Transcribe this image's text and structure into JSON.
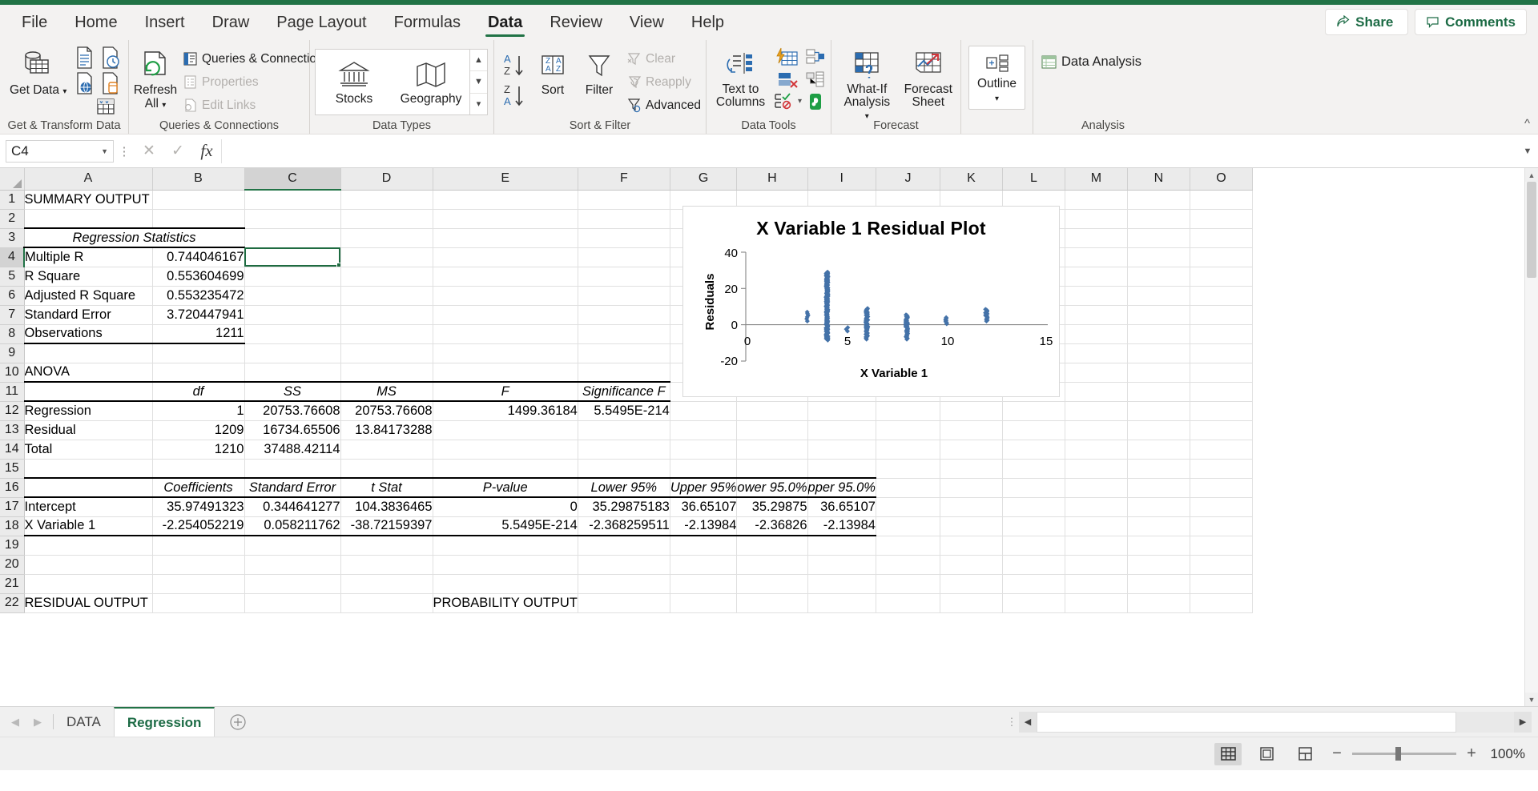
{
  "ribbon": {
    "tabs": [
      {
        "label": "File",
        "active": false
      },
      {
        "label": "Home",
        "active": false
      },
      {
        "label": "Insert",
        "active": false
      },
      {
        "label": "Draw",
        "active": false
      },
      {
        "label": "Page Layout",
        "active": false
      },
      {
        "label": "Formulas",
        "active": false
      },
      {
        "label": "Data",
        "active": true
      },
      {
        "label": "Review",
        "active": false
      },
      {
        "label": "View",
        "active": false
      },
      {
        "label": "Help",
        "active": false
      }
    ],
    "share_label": "Share",
    "comments_label": "Comments",
    "groups": {
      "get_transform": {
        "label": "Get & Transform Data",
        "get_data": "Get Data"
      },
      "queries": {
        "label": "Queries & Connections",
        "refresh_all": "Refresh All",
        "queries_connections": "Queries & Connections",
        "properties": "Properties",
        "edit_links": "Edit Links"
      },
      "data_types": {
        "label": "Data Types",
        "stocks": "Stocks",
        "geography": "Geography"
      },
      "sort_filter": {
        "label": "Sort & Filter",
        "sort": "Sort",
        "filter": "Filter",
        "clear": "Clear",
        "reapply": "Reapply",
        "advanced": "Advanced"
      },
      "data_tools": {
        "label": "Data Tools",
        "text_to_columns": "Text to Columns"
      },
      "forecast": {
        "label": "Forecast",
        "what_if": "What-If Analysis",
        "forecast_sheet": "Forecast Sheet"
      },
      "outline": {
        "label": "",
        "outline": "Outline"
      },
      "analysis": {
        "label": "Analysis",
        "data_analysis": "Data Analysis"
      }
    }
  },
  "formula_bar": {
    "name_box_value": "C4",
    "formula_value": ""
  },
  "grid": {
    "columns": [
      "A",
      "B",
      "C",
      "D",
      "E",
      "F",
      "G",
      "H",
      "I",
      "J",
      "K",
      "L",
      "M",
      "N",
      "O"
    ],
    "selected_column": "C",
    "selected_row": "4",
    "selected_cell": "C4",
    "rows": [
      {
        "n": "1",
        "cells": {
          "A": "SUMMARY OUTPUT"
        }
      },
      {
        "n": "2",
        "cells": {}
      },
      {
        "n": "3",
        "cells": {
          "AB": "Regression Statistics"
        }
      },
      {
        "n": "4",
        "cells": {
          "A": "Multiple R",
          "B": "0.744046167"
        }
      },
      {
        "n": "5",
        "cells": {
          "A": "R Square",
          "B": "0.553604699"
        }
      },
      {
        "n": "6",
        "cells": {
          "A": "Adjusted R Square",
          "B": "0.553235472"
        }
      },
      {
        "n": "7",
        "cells": {
          "A": "Standard Error",
          "B": "3.720447941"
        }
      },
      {
        "n": "8",
        "cells": {
          "A": "Observations",
          "B": "1211"
        }
      },
      {
        "n": "9",
        "cells": {}
      },
      {
        "n": "10",
        "cells": {
          "A": "ANOVA"
        }
      },
      {
        "n": "11",
        "cells": {
          "B": "df",
          "C": "SS",
          "D": "MS",
          "E": "F",
          "F": "Significance F"
        }
      },
      {
        "n": "12",
        "cells": {
          "A": "Regression",
          "B": "1",
          "C": "20753.76608",
          "D": "20753.76608",
          "E": "1499.36184",
          "F": "5.5495E-214"
        }
      },
      {
        "n": "13",
        "cells": {
          "A": "Residual",
          "B": "1209",
          "C": "16734.65506",
          "D": "13.84173288"
        }
      },
      {
        "n": "14",
        "cells": {
          "A": "Total",
          "B": "1210",
          "C": "37488.42114"
        }
      },
      {
        "n": "15",
        "cells": {}
      },
      {
        "n": "16",
        "cells": {
          "B": "Coefficients",
          "C": "Standard Error",
          "D": "t Stat",
          "E": "P-value",
          "F": "Lower 95%",
          "G": "Upper 95%",
          "H": "ower 95.0%",
          "I": "pper 95.0%"
        }
      },
      {
        "n": "17",
        "cells": {
          "A": "Intercept",
          "B": "35.97491323",
          "C": "0.344641277",
          "D": "104.3836465",
          "E": "0",
          "F": "35.29875183",
          "G": "36.65107",
          "H": "35.29875",
          "I": "36.65107"
        }
      },
      {
        "n": "18",
        "cells": {
          "A": "X Variable 1",
          "B": "-2.254052219",
          "C": "0.058211762",
          "D": "-38.72159397",
          "E": "5.5495E-214",
          "F": "-2.368259511",
          "G": "-2.13984",
          "H": "-2.36826",
          "I": "-2.13984"
        }
      },
      {
        "n": "19",
        "cells": {}
      },
      {
        "n": "20",
        "cells": {}
      },
      {
        "n": "21",
        "cells": {}
      },
      {
        "n": "22",
        "cells": {
          "A": "RESIDUAL OUTPUT",
          "E": "PROBABILITY OUTPUT"
        }
      }
    ]
  },
  "chart_data": {
    "type": "scatter",
    "title": "X Variable 1  Residual Plot",
    "xlabel": "X Variable 1",
    "ylabel": "Residuals",
    "xlim": [
      0,
      15
    ],
    "ylim": [
      -20,
      40
    ],
    "xticks": [
      "0",
      "5",
      "10",
      "15"
    ],
    "yticks": [
      "40",
      "20",
      "0",
      "-20"
    ],
    "grid": false,
    "legend": "none",
    "marker_color": "#4472a8",
    "clusters": [
      {
        "x": 3,
        "y_min": 2.0,
        "y_max": 7.0,
        "n": 6
      },
      {
        "x": 4,
        "y_min": -8.5,
        "y_max": 29.0,
        "n": 170
      },
      {
        "x": 5,
        "y_min": -3.5,
        "y_max": -1.5,
        "n": 3
      },
      {
        "x": 6,
        "y_min": -8.0,
        "y_max": 9.0,
        "n": 60
      },
      {
        "x": 8,
        "y_min": -8.0,
        "y_max": 5.5,
        "n": 45
      },
      {
        "x": 10,
        "y_min": 0.5,
        "y_max": 4.0,
        "n": 8
      },
      {
        "x": 12,
        "y_min": 2.0,
        "y_max": 8.5,
        "n": 22
      }
    ]
  },
  "sheet_tabs": {
    "tabs": [
      {
        "label": "DATA",
        "active": false
      },
      {
        "label": "Regression",
        "active": true
      }
    ],
    "add_label": "+"
  },
  "status_bar": {
    "zoom_label": "100%",
    "views": [
      {
        "name": "normal-view",
        "active": true
      },
      {
        "name": "page-layout-view",
        "active": false
      },
      {
        "name": "page-break-view",
        "active": false
      }
    ]
  },
  "colors": {
    "excel_green": "#217346",
    "chart_marker": "#4472a8",
    "selection": "#1e6b41"
  }
}
